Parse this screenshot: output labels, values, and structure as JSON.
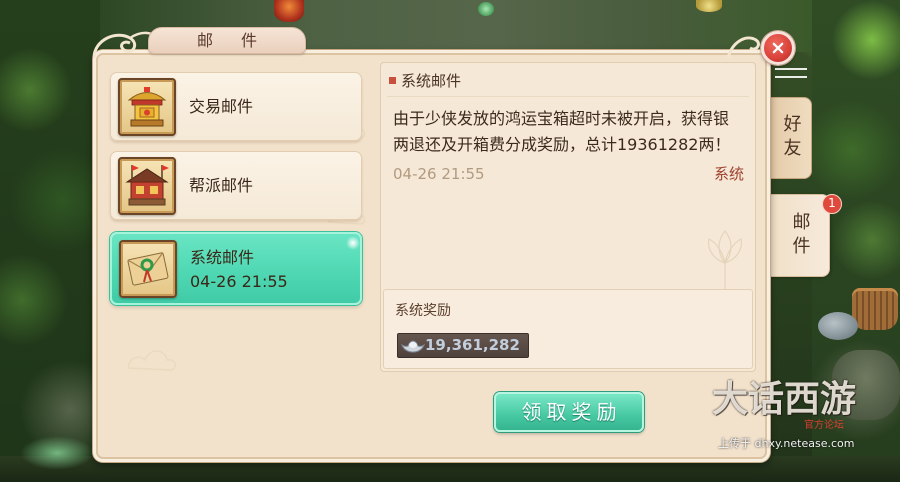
{
  "dialog": {
    "title": "邮件",
    "close_icon": "close-icon"
  },
  "mail_list": {
    "items": [
      {
        "label": "交易邮件",
        "icon": "trade-pavilion-icon",
        "selected": false
      },
      {
        "label": "帮派邮件",
        "icon": "guild-hall-icon",
        "selected": false
      },
      {
        "label": "系统邮件",
        "date": "04-26 21:55",
        "icon": "envelope-icon",
        "selected": true
      }
    ]
  },
  "mail_detail": {
    "title": "系统邮件",
    "body_lines": [
      "由于少侠发放的鸿运宝箱超时未被开启，获得银",
      "两退还及开箱费分成奖励，总计19361282两！"
    ],
    "date": "04-26 21:55",
    "sender": "系统",
    "reward": {
      "label": "系统奖励",
      "icon": "silver-ingot-icon",
      "amount": "19,361,282"
    },
    "claim_button": "领取奖励"
  },
  "side_tabs": [
    {
      "label": "好友",
      "active": false
    },
    {
      "label": "邮件",
      "active": true,
      "badge": "1"
    }
  ],
  "watermark": {
    "logo": "大话西游",
    "forum": "官方论坛",
    "upload": "上传于 dhxy.netease.com"
  },
  "colors": {
    "parchment": "#f2e2cc",
    "selected_item": "#4fd8b3",
    "claim_button": "#46c9a2",
    "close_button": "#d8423a",
    "sender_text": "#a0412f",
    "badge": "#e04a3c"
  }
}
